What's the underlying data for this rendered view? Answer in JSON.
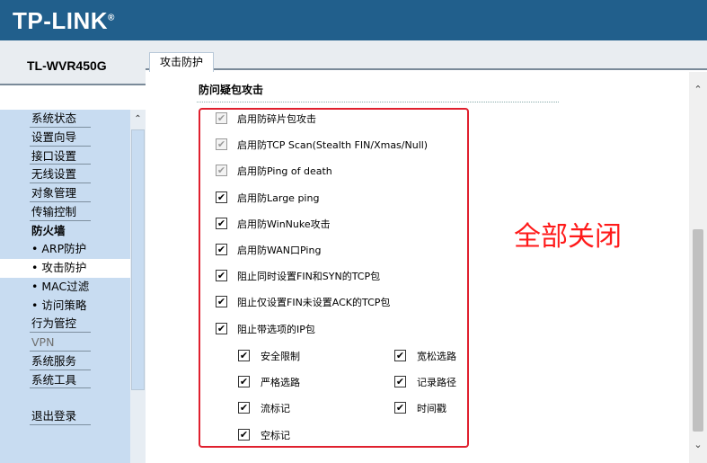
{
  "header": {
    "logo": "TP-LINK",
    "logo_mark": "®"
  },
  "model": "TL-WVR450G",
  "tab": {
    "label": "攻击防护"
  },
  "menu": [
    {
      "label": "系统状态",
      "type": "item"
    },
    {
      "label": "设置向导",
      "type": "item"
    },
    {
      "label": "接口设置",
      "type": "item"
    },
    {
      "label": "无线设置",
      "type": "item"
    },
    {
      "label": "对象管理",
      "type": "item"
    },
    {
      "label": "传输控制",
      "type": "item"
    },
    {
      "label": "防火墙",
      "type": "section"
    },
    {
      "label": "• ARP防护",
      "type": "sub"
    },
    {
      "label": "• 攻击防护",
      "type": "sub",
      "active": true
    },
    {
      "label": "• MAC过滤",
      "type": "sub"
    },
    {
      "label": "• 访问策略",
      "type": "sub"
    },
    {
      "label": "行为管控",
      "type": "item"
    },
    {
      "label": "VPN",
      "type": "item",
      "dim": true
    },
    {
      "label": "系统服务",
      "type": "item"
    },
    {
      "label": "系统工具",
      "type": "item"
    },
    {
      "label": "",
      "type": "gap"
    },
    {
      "label": "退出登录",
      "type": "item"
    }
  ],
  "section_title": "防问疑包攻击",
  "options": [
    {
      "label": "启用防碎片包攻击",
      "checked": true,
      "disabled": true
    },
    {
      "label": "启用防TCP Scan(Stealth FIN/Xmas/Null)",
      "checked": true,
      "disabled": true
    },
    {
      "label": "启用防Ping of death",
      "checked": true,
      "disabled": true
    },
    {
      "label": "启用防Large ping",
      "checked": true,
      "disabled": false
    },
    {
      "label": "启用防WinNuke攻击",
      "checked": true,
      "disabled": false
    },
    {
      "label": "启用防WAN口Ping",
      "checked": true,
      "disabled": false
    },
    {
      "label": "阻止同时设置FIN和SYN的TCP包",
      "checked": true,
      "disabled": false
    },
    {
      "label": "阻止仅设置FIN未设置ACK的TCP包",
      "checked": true,
      "disabled": false
    },
    {
      "label": "阻止带选项的IP包",
      "checked": true,
      "disabled": false
    }
  ],
  "ip_options": [
    {
      "label": "安全限制",
      "checked": true
    },
    {
      "label": "宽松选路",
      "checked": true
    },
    {
      "label": "严格选路",
      "checked": true
    },
    {
      "label": "记录路径",
      "checked": true
    },
    {
      "label": "流标记",
      "checked": true
    },
    {
      "label": "时间戳",
      "checked": true
    },
    {
      "label": "空标记",
      "checked": true
    }
  ],
  "annotation": "全部关闭",
  "icons": {
    "check": "✔",
    "scroll_up": "⌃",
    "scroll_down": "⌄"
  },
  "colors": {
    "header": "#215f8c",
    "menu_bg": "#c8dcf1",
    "highlight": "#e0202e"
  }
}
